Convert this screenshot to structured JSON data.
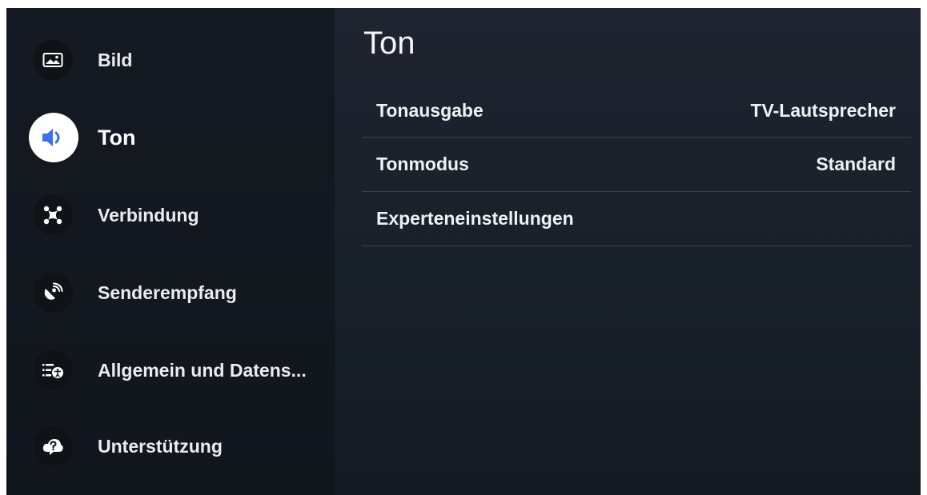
{
  "sidebar": {
    "items": [
      {
        "label": "Bild",
        "icon": "picture-icon"
      },
      {
        "label": "Ton",
        "icon": "speaker-icon",
        "active": true
      },
      {
        "label": "Verbindung",
        "icon": "network-icon"
      },
      {
        "label": "Senderempfang",
        "icon": "satellite-dish-icon"
      },
      {
        "label": "Allgemein und Datens...",
        "icon": "accessibility-list-icon"
      },
      {
        "label": "Unterstützung",
        "icon": "help-cloud-icon"
      }
    ]
  },
  "main": {
    "title": "Ton",
    "settings": [
      {
        "name": "Tonausgabe",
        "value": "TV-Lautsprecher"
      },
      {
        "name": "Tonmodus",
        "value": "Standard"
      },
      {
        "name": "Experteneinstellungen",
        "value": ""
      }
    ]
  },
  "colors": {
    "accent": "#3b6ff0",
    "sidebar_bg": "#141920",
    "main_bg": "#1b222c",
    "text": "#eef1f4",
    "divider": "#3a4350"
  }
}
